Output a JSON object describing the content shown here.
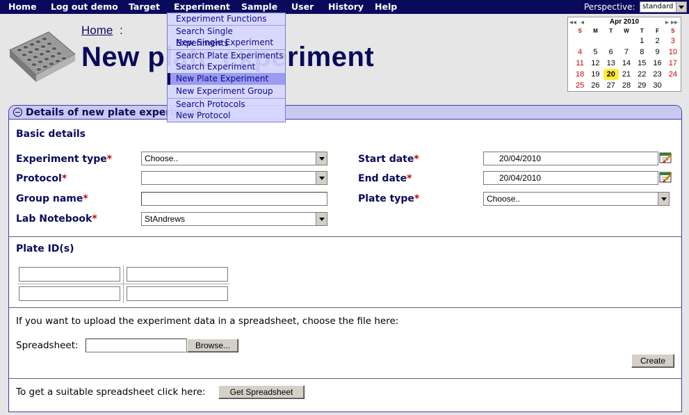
{
  "nav": {
    "items": [
      "Home",
      "Log out demo",
      "Target",
      "Experiment",
      "Sample",
      "User",
      "History",
      "Help"
    ],
    "perspective_label": "Perspective:",
    "perspective_value": "standard"
  },
  "menu": {
    "items": [
      "Experiment Functions",
      "Search Single Experiments",
      "New Single Experiment",
      "Search Plate Experiments",
      "Search Experiment Groups",
      "New Plate Experiment",
      "New Experiment Group",
      "Search Protocols",
      "New Protocol"
    ],
    "active": "New Plate Experiment"
  },
  "header": {
    "breadcrumb_home": "Home",
    "breadcrumb_sep": ":",
    "title": "New plate experiment"
  },
  "calendar": {
    "prev_year": "◂◂",
    "prev_month": "◂",
    "next_month": "▸",
    "next_year": "▸▸",
    "month_label": "Apr 2010",
    "weekdays": [
      "S",
      "M",
      "T",
      "W",
      "T",
      "F",
      "S"
    ],
    "weeks": [
      [
        "",
        "",
        "",
        "",
        "1",
        "2",
        "3"
      ],
      [
        "4",
        "5",
        "6",
        "7",
        "8",
        "9",
        "10"
      ],
      [
        "11",
        "12",
        "13",
        "14",
        "15",
        "16",
        "17"
      ],
      [
        "18",
        "19",
        "20",
        "21",
        "22",
        "23",
        "24"
      ],
      [
        "25",
        "26",
        "27",
        "28",
        "29",
        "30",
        ""
      ]
    ],
    "today": "20"
  },
  "panel": {
    "title": "Details of new plate experiment",
    "basic_details": "Basic details",
    "experiment_type_label": "Experiment type",
    "experiment_type_value": "Choose..",
    "protocol_label": "Protocol",
    "protocol_value": "",
    "group_name_label": "Group name",
    "group_name_value": "",
    "lab_notebook_label": "Lab Notebook",
    "lab_notebook_value": "StAndrews",
    "start_date_label": "Start date",
    "start_date_value": "20/04/2010",
    "end_date_label": "End date",
    "end_date_value": "20/04/2010",
    "plate_type_label": "Plate type",
    "plate_type_value": "Choose..",
    "required_marker": "*",
    "plate_ids_title": "Plate ID(s)",
    "upload_text": "If you want to upload the experiment data in a spreadsheet, choose the file here:",
    "spreadsheet_label": "Spreadsheet:",
    "browse_label": "Browse...",
    "create_label": "Create",
    "get_text": "To get a suitable spreadsheet click here:",
    "get_button": "Get Spreadsheet"
  },
  "colors": {
    "nav_bg": "#0a0a5c",
    "label": "#0a0a5c",
    "required": "#cc0000",
    "menu_bg": "#d7d7ff",
    "menu_active": "#9b9bef",
    "today_highlight": "#ffee33"
  }
}
